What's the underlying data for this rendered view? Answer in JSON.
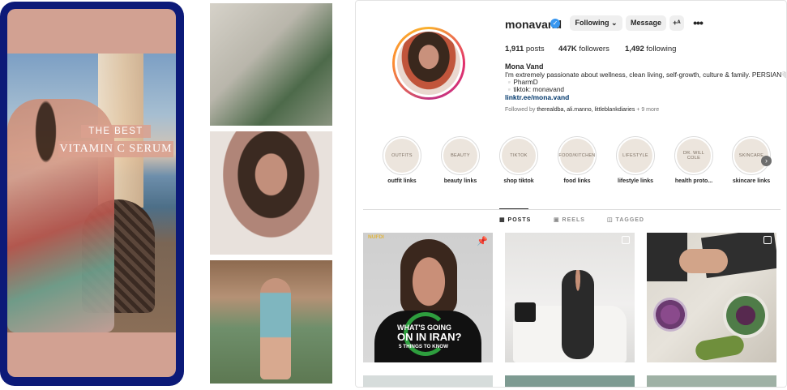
{
  "phone": {
    "headline_line1": "THE BEST",
    "headline_line2": "VITAMIN C SERUM"
  },
  "profile": {
    "username": "monavand",
    "verified_icon": "✓",
    "buttons": {
      "following": "Following ⌄",
      "message": "Message",
      "add_user": "+ᴬ",
      "more": "•••"
    },
    "stats": {
      "posts_count": "1,911",
      "posts_label": "posts",
      "followers_count": "447K",
      "followers_label": "followers",
      "following_count": "1,492",
      "following_label": "following"
    },
    "bio": {
      "name": "Mona Vand",
      "line1": "I'm extremely passionate about wellness, clean living, self-growth, culture & family. PERSIAN🤍",
      "line2": "▫️PharmD",
      "line3": "▫️tiktok: monavand",
      "link": "linktr.ee/mona.vand"
    },
    "followed_by": {
      "prefix": "Followed by",
      "names": "therealdba, ali.manno, littleblankdiaries",
      "more": "+ 9 more"
    }
  },
  "highlights": [
    {
      "cover": "OUTFITS",
      "label": "outfit links"
    },
    {
      "cover": "BEAUTY",
      "label": "beauty links"
    },
    {
      "cover": "TIKTOK",
      "label": "shop tiktok"
    },
    {
      "cover": "FOOD/KITCHEN",
      "label": "food links"
    },
    {
      "cover": "LIFESTYLE",
      "label": "lifestyle links"
    },
    {
      "cover": "DR. WILL COLE",
      "label": "health proto..."
    },
    {
      "cover": "SKINCARE",
      "label": "skincare links"
    }
  ],
  "highlights_next_icon": "›",
  "tabs": [
    {
      "label": "▦  POSTS",
      "active": true
    },
    {
      "label": "▣  REELS",
      "active": false
    },
    {
      "label": "◫  TAGGED",
      "active": false
    }
  ],
  "posts": {
    "post1": {
      "brand": "NUFDI",
      "line1": "WHAT'S GOING",
      "line2": "ON IN IRAN?",
      "line3": "5 THINGS TO KNOW",
      "pin_icon": "📌"
    }
  },
  "colors": {
    "phone_frame": "#0c1a78",
    "phone_bg": "#d2a192",
    "link": "#00376b",
    "verified": "#3897f0",
    "button_bg": "#efefef"
  }
}
